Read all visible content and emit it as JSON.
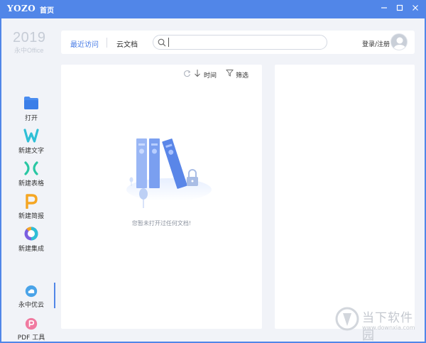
{
  "title_bar": {
    "logo_text": "YOZO",
    "tab_label": "首页",
    "buttons": [
      "minimize",
      "maximize",
      "close"
    ]
  },
  "brand": {
    "year": "2019",
    "name": "永中Office"
  },
  "sidebar": {
    "items": [
      {
        "label": "打开",
        "icon": "folder-icon"
      },
      {
        "label": "新建文字",
        "icon": "word-icon"
      },
      {
        "label": "新建表格",
        "icon": "spreadsheet-icon"
      },
      {
        "label": "新建简报",
        "icon": "presentation-icon"
      },
      {
        "label": "新建集成",
        "icon": "integration-icon"
      }
    ],
    "bottom_items": [
      {
        "label": "永中优云",
        "icon": "cloud-icon",
        "active": true
      },
      {
        "label": "PDF 工具",
        "icon": "pdf-icon"
      }
    ]
  },
  "topbar": {
    "tabs": [
      {
        "label": "最近访问",
        "active": true
      },
      {
        "label": "云文档",
        "active": false
      }
    ],
    "search_placeholder": "",
    "login_label": "登录/注册"
  },
  "file_panel": {
    "sort_label": "时间",
    "filter_label": "筛选",
    "empty_message": "您暂未打开过任何文档!"
  },
  "watermark": {
    "title": "当下软件园",
    "url": "www.downxia.com"
  },
  "colors": {
    "accent": "#5186e8",
    "background": "#f1f3f8",
    "word": "#2fbfd6",
    "spreadsheet": "#29c7a3",
    "presentation": "#f5a623",
    "folder": "#4a8cf0"
  }
}
